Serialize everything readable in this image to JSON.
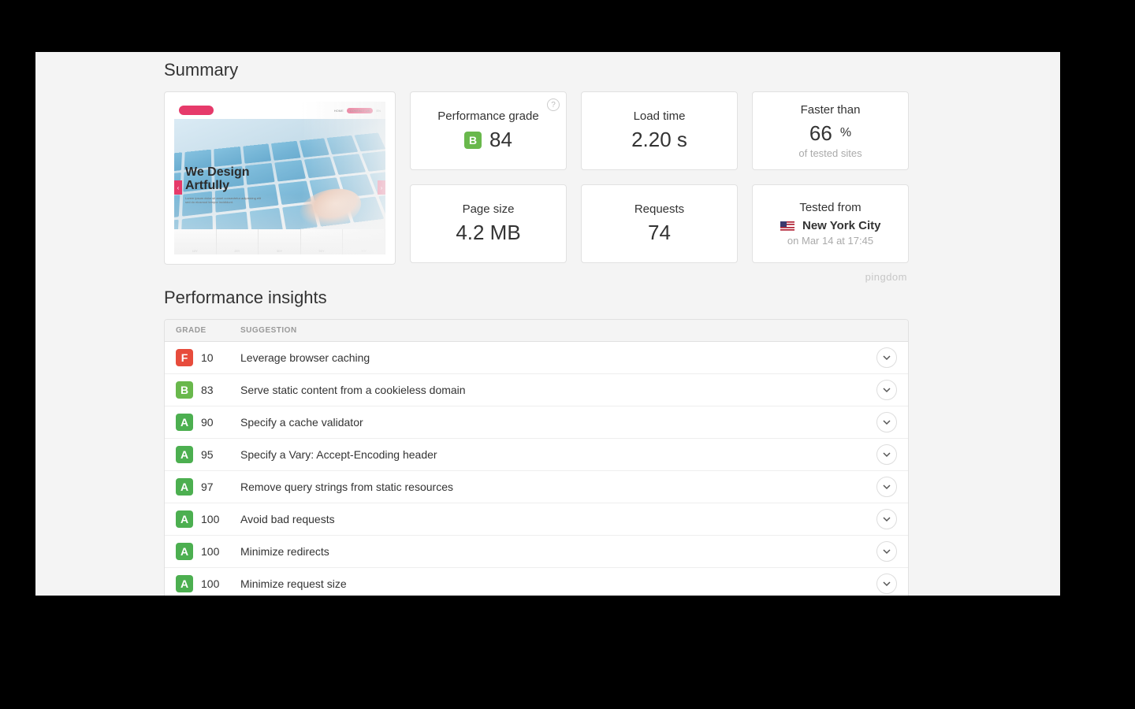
{
  "summary": {
    "heading": "Summary",
    "thumbnail": {
      "headline1": "We Design",
      "headline2": "Artfully",
      "nav_items": [
        "HOME",
        "CONTACT US",
        "EN"
      ],
      "tabs": [
        "10Y",
        "20Y",
        "30Y",
        "50Y",
        "70Y"
      ]
    },
    "metrics": {
      "perf_grade": {
        "label": "Performance grade",
        "letter": "B",
        "score": "84"
      },
      "load_time": {
        "label": "Load time",
        "value": "2.20 s"
      },
      "faster_than": {
        "label": "Faster than",
        "value": "66",
        "unit": "%",
        "sub": "of tested sites"
      },
      "page_size": {
        "label": "Page size",
        "value": "4.2 MB"
      },
      "requests": {
        "label": "Requests",
        "value": "74"
      },
      "tested_from": {
        "label": "Tested from",
        "location": "New York City",
        "timestamp": "on Mar 14 at 17:45"
      }
    },
    "brand": "pingdom"
  },
  "insights": {
    "heading": "Performance insights",
    "columns": {
      "grade": "GRADE",
      "suggestion": "SUGGESTION"
    },
    "rows": [
      {
        "letter": "F",
        "score": "10",
        "text": "Leverage browser caching"
      },
      {
        "letter": "B",
        "score": "83",
        "text": "Serve static content from a cookieless domain"
      },
      {
        "letter": "A",
        "score": "90",
        "text": "Specify a cache validator"
      },
      {
        "letter": "A",
        "score": "95",
        "text": "Specify a Vary: Accept-Encoding header"
      },
      {
        "letter": "A",
        "score": "97",
        "text": "Remove query strings from static resources"
      },
      {
        "letter": "A",
        "score": "100",
        "text": "Avoid bad requests"
      },
      {
        "letter": "A",
        "score": "100",
        "text": "Minimize redirects"
      },
      {
        "letter": "A",
        "score": "100",
        "text": "Minimize request size"
      }
    ]
  }
}
